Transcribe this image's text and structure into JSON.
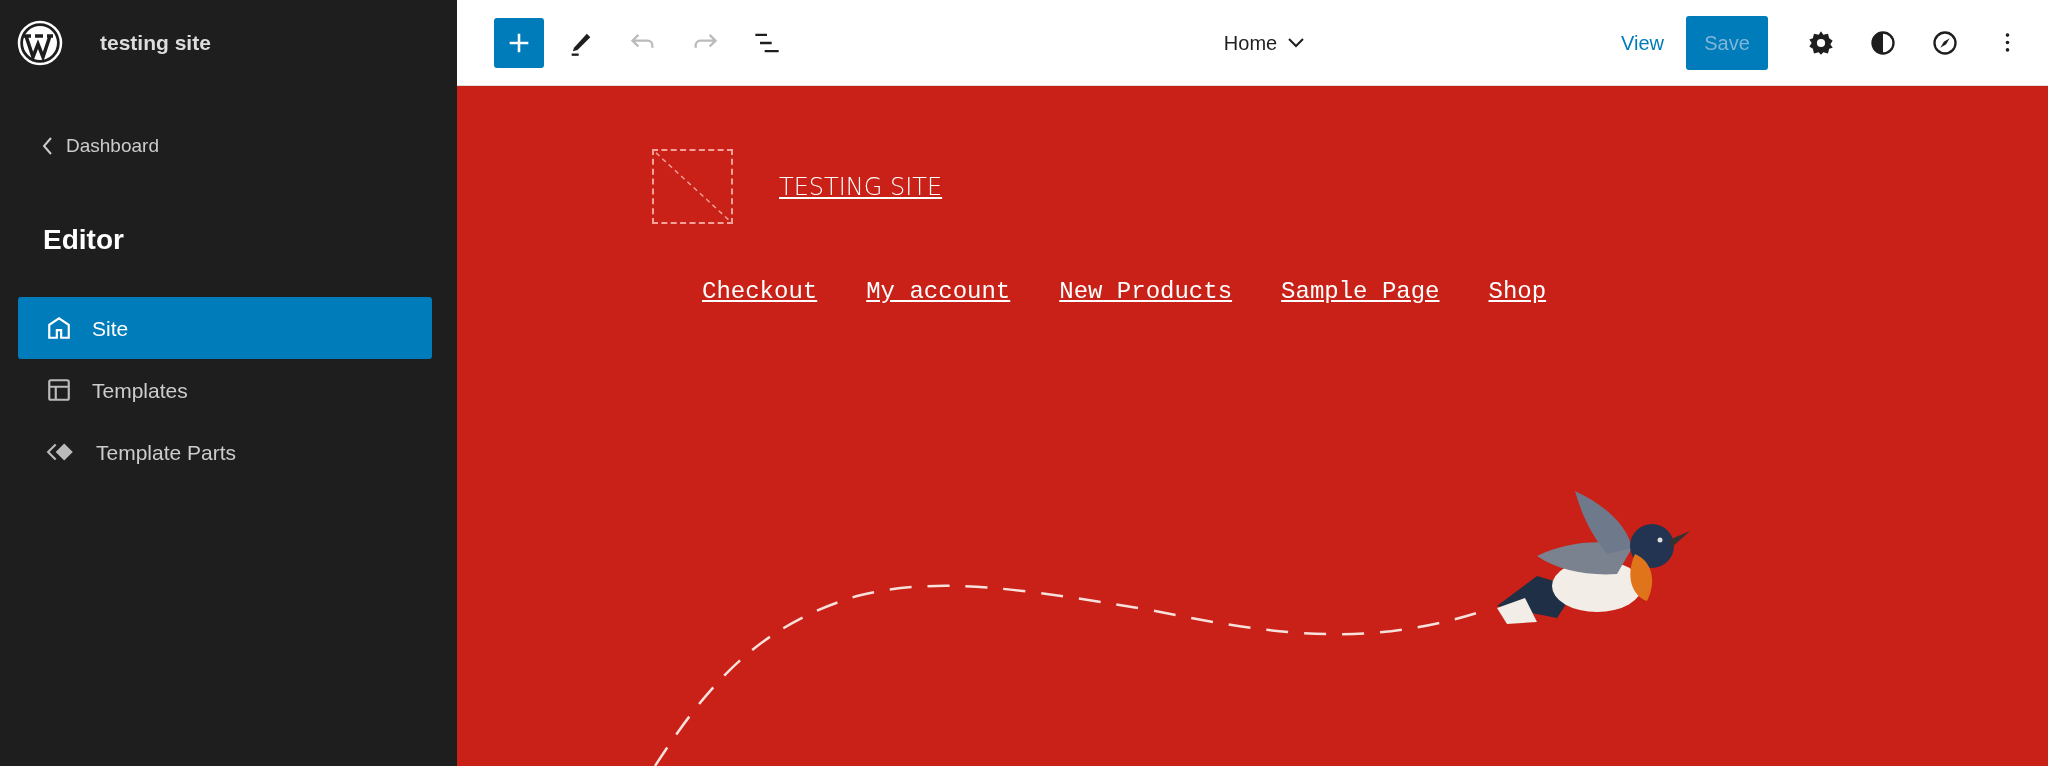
{
  "sidebar": {
    "site_title": "testing site",
    "back_link": "Dashboard",
    "heading": "Editor",
    "items": [
      {
        "label": "Site",
        "kind": "home",
        "selected": true
      },
      {
        "label": "Templates",
        "kind": "layout",
        "selected": false
      },
      {
        "label": "Template Parts",
        "kind": "parts",
        "selected": false
      }
    ]
  },
  "toolbar": {
    "tools": [
      {
        "kind": "add",
        "disabled": false
      },
      {
        "kind": "edit",
        "disabled": false
      },
      {
        "kind": "undo",
        "disabled": true
      },
      {
        "kind": "redo",
        "disabled": true
      },
      {
        "kind": "list",
        "disabled": false
      }
    ],
    "document_title": "Home",
    "view": "View",
    "save": {
      "label": "Save",
      "disabled": true
    },
    "actions": [
      {
        "kind": "settings"
      },
      {
        "kind": "styles"
      },
      {
        "kind": "navigate"
      },
      {
        "kind": "more"
      }
    ]
  },
  "canvas": {
    "site_title": "TESTING SITE",
    "nav": [
      "Checkout",
      "My account",
      "New Products",
      "Sample Page",
      "Shop"
    ]
  }
}
